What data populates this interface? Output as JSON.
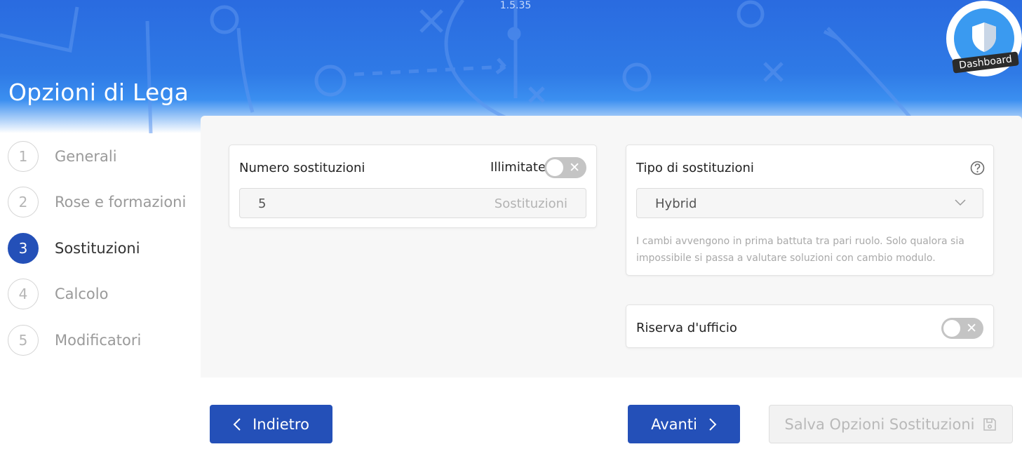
{
  "app": {
    "version": "1.5.35",
    "title": "Opzioni di Lega"
  },
  "dashboard": {
    "label": "Dashboard",
    "icon": "shield-icon"
  },
  "steps": [
    {
      "num": "1",
      "label": "Generali",
      "active": false
    },
    {
      "num": "2",
      "label": "Rose e formazioni",
      "active": false
    },
    {
      "num": "3",
      "label": "Sostituzioni",
      "active": true
    },
    {
      "num": "4",
      "label": "Calcolo",
      "active": false
    },
    {
      "num": "5",
      "label": "Modificatori",
      "active": false
    }
  ],
  "substitutions": {
    "title": "Numero sostituzioni",
    "unlimited_label": "Illimitate",
    "unlimited_on": false,
    "value": "5",
    "suffix": "Sostituzioni"
  },
  "sub_type": {
    "title": "Tipo di sostituzioni",
    "selected": "Hybrid",
    "description_line1": "I cambi avvengono in prima battuta tra pari ruolo. Solo qualora sia",
    "description_line2": "impossibile si passa a valutare soluzioni con cambio modulo."
  },
  "reserve": {
    "title": "Riserva d'ufficio",
    "on": false
  },
  "buttons": {
    "back": "Indietro",
    "next": "Avanti",
    "save": "Salva Opzioni Sostituzioni"
  },
  "colors": {
    "primary": "#2450b8",
    "header": "#2f7ae6",
    "dashboard": "#3a9af0"
  }
}
